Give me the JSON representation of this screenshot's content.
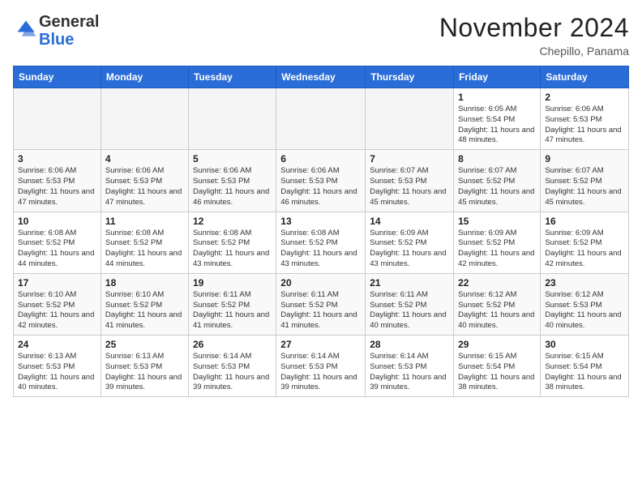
{
  "header": {
    "logo_general": "General",
    "logo_blue": "Blue",
    "month_title": "November 2024",
    "subtitle": "Chepillo, Panama"
  },
  "weekdays": [
    "Sunday",
    "Monday",
    "Tuesday",
    "Wednesday",
    "Thursday",
    "Friday",
    "Saturday"
  ],
  "weeks": [
    [
      {
        "day": "",
        "content": ""
      },
      {
        "day": "",
        "content": ""
      },
      {
        "day": "",
        "content": ""
      },
      {
        "day": "",
        "content": ""
      },
      {
        "day": "",
        "content": ""
      },
      {
        "day": "1",
        "content": "Sunrise: 6:05 AM\nSunset: 5:54 PM\nDaylight: 11 hours and 48 minutes."
      },
      {
        "day": "2",
        "content": "Sunrise: 6:06 AM\nSunset: 5:53 PM\nDaylight: 11 hours and 47 minutes."
      }
    ],
    [
      {
        "day": "3",
        "content": "Sunrise: 6:06 AM\nSunset: 5:53 PM\nDaylight: 11 hours and 47 minutes."
      },
      {
        "day": "4",
        "content": "Sunrise: 6:06 AM\nSunset: 5:53 PM\nDaylight: 11 hours and 47 minutes."
      },
      {
        "day": "5",
        "content": "Sunrise: 6:06 AM\nSunset: 5:53 PM\nDaylight: 11 hours and 46 minutes."
      },
      {
        "day": "6",
        "content": "Sunrise: 6:06 AM\nSunset: 5:53 PM\nDaylight: 11 hours and 46 minutes."
      },
      {
        "day": "7",
        "content": "Sunrise: 6:07 AM\nSunset: 5:53 PM\nDaylight: 11 hours and 45 minutes."
      },
      {
        "day": "8",
        "content": "Sunrise: 6:07 AM\nSunset: 5:52 PM\nDaylight: 11 hours and 45 minutes."
      },
      {
        "day": "9",
        "content": "Sunrise: 6:07 AM\nSunset: 5:52 PM\nDaylight: 11 hours and 45 minutes."
      }
    ],
    [
      {
        "day": "10",
        "content": "Sunrise: 6:08 AM\nSunset: 5:52 PM\nDaylight: 11 hours and 44 minutes."
      },
      {
        "day": "11",
        "content": "Sunrise: 6:08 AM\nSunset: 5:52 PM\nDaylight: 11 hours and 44 minutes."
      },
      {
        "day": "12",
        "content": "Sunrise: 6:08 AM\nSunset: 5:52 PM\nDaylight: 11 hours and 43 minutes."
      },
      {
        "day": "13",
        "content": "Sunrise: 6:08 AM\nSunset: 5:52 PM\nDaylight: 11 hours and 43 minutes."
      },
      {
        "day": "14",
        "content": "Sunrise: 6:09 AM\nSunset: 5:52 PM\nDaylight: 11 hours and 43 minutes."
      },
      {
        "day": "15",
        "content": "Sunrise: 6:09 AM\nSunset: 5:52 PM\nDaylight: 11 hours and 42 minutes."
      },
      {
        "day": "16",
        "content": "Sunrise: 6:09 AM\nSunset: 5:52 PM\nDaylight: 11 hours and 42 minutes."
      }
    ],
    [
      {
        "day": "17",
        "content": "Sunrise: 6:10 AM\nSunset: 5:52 PM\nDaylight: 11 hours and 42 minutes."
      },
      {
        "day": "18",
        "content": "Sunrise: 6:10 AM\nSunset: 5:52 PM\nDaylight: 11 hours and 41 minutes."
      },
      {
        "day": "19",
        "content": "Sunrise: 6:11 AM\nSunset: 5:52 PM\nDaylight: 11 hours and 41 minutes."
      },
      {
        "day": "20",
        "content": "Sunrise: 6:11 AM\nSunset: 5:52 PM\nDaylight: 11 hours and 41 minutes."
      },
      {
        "day": "21",
        "content": "Sunrise: 6:11 AM\nSunset: 5:52 PM\nDaylight: 11 hours and 40 minutes."
      },
      {
        "day": "22",
        "content": "Sunrise: 6:12 AM\nSunset: 5:52 PM\nDaylight: 11 hours and 40 minutes."
      },
      {
        "day": "23",
        "content": "Sunrise: 6:12 AM\nSunset: 5:53 PM\nDaylight: 11 hours and 40 minutes."
      }
    ],
    [
      {
        "day": "24",
        "content": "Sunrise: 6:13 AM\nSunset: 5:53 PM\nDaylight: 11 hours and 40 minutes."
      },
      {
        "day": "25",
        "content": "Sunrise: 6:13 AM\nSunset: 5:53 PM\nDaylight: 11 hours and 39 minutes."
      },
      {
        "day": "26",
        "content": "Sunrise: 6:14 AM\nSunset: 5:53 PM\nDaylight: 11 hours and 39 minutes."
      },
      {
        "day": "27",
        "content": "Sunrise: 6:14 AM\nSunset: 5:53 PM\nDaylight: 11 hours and 39 minutes."
      },
      {
        "day": "28",
        "content": "Sunrise: 6:14 AM\nSunset: 5:53 PM\nDaylight: 11 hours and 39 minutes."
      },
      {
        "day": "29",
        "content": "Sunrise: 6:15 AM\nSunset: 5:54 PM\nDaylight: 11 hours and 38 minutes."
      },
      {
        "day": "30",
        "content": "Sunrise: 6:15 AM\nSunset: 5:54 PM\nDaylight: 11 hours and 38 minutes."
      }
    ]
  ]
}
